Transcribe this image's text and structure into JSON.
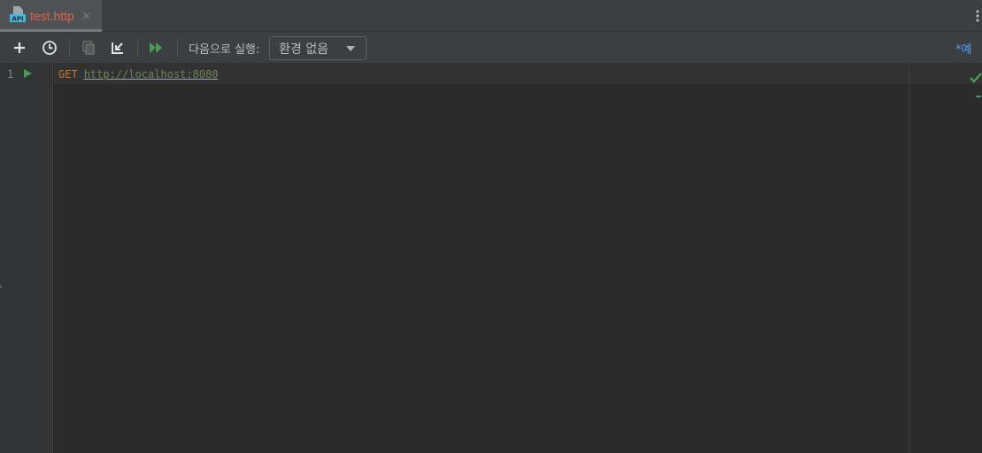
{
  "tab": {
    "icon": "api-file-icon",
    "label": "test.http",
    "close_symbol": "×"
  },
  "toolbar": {
    "add_icon": "plus-icon",
    "history_icon": "clock-icon",
    "copy_icon": "copy-icon",
    "import_icon": "import-arrow-icon",
    "run_all_icon": "run-all-icon",
    "run_with_label": "다음으로 실행:",
    "environment_value": "환경 없음",
    "examples_label": "*예"
  },
  "editor": {
    "line_numbers": [
      "1"
    ],
    "method": "GET",
    "url": "http://localhost:8080"
  },
  "colors": {
    "background": "#2b2b2b",
    "toolbar": "#3c3f41",
    "tab_label": "#e0644c",
    "method": "#cc7832",
    "url": "#6a8759",
    "run_green": "#499c54",
    "link_blue": "#589df6"
  }
}
